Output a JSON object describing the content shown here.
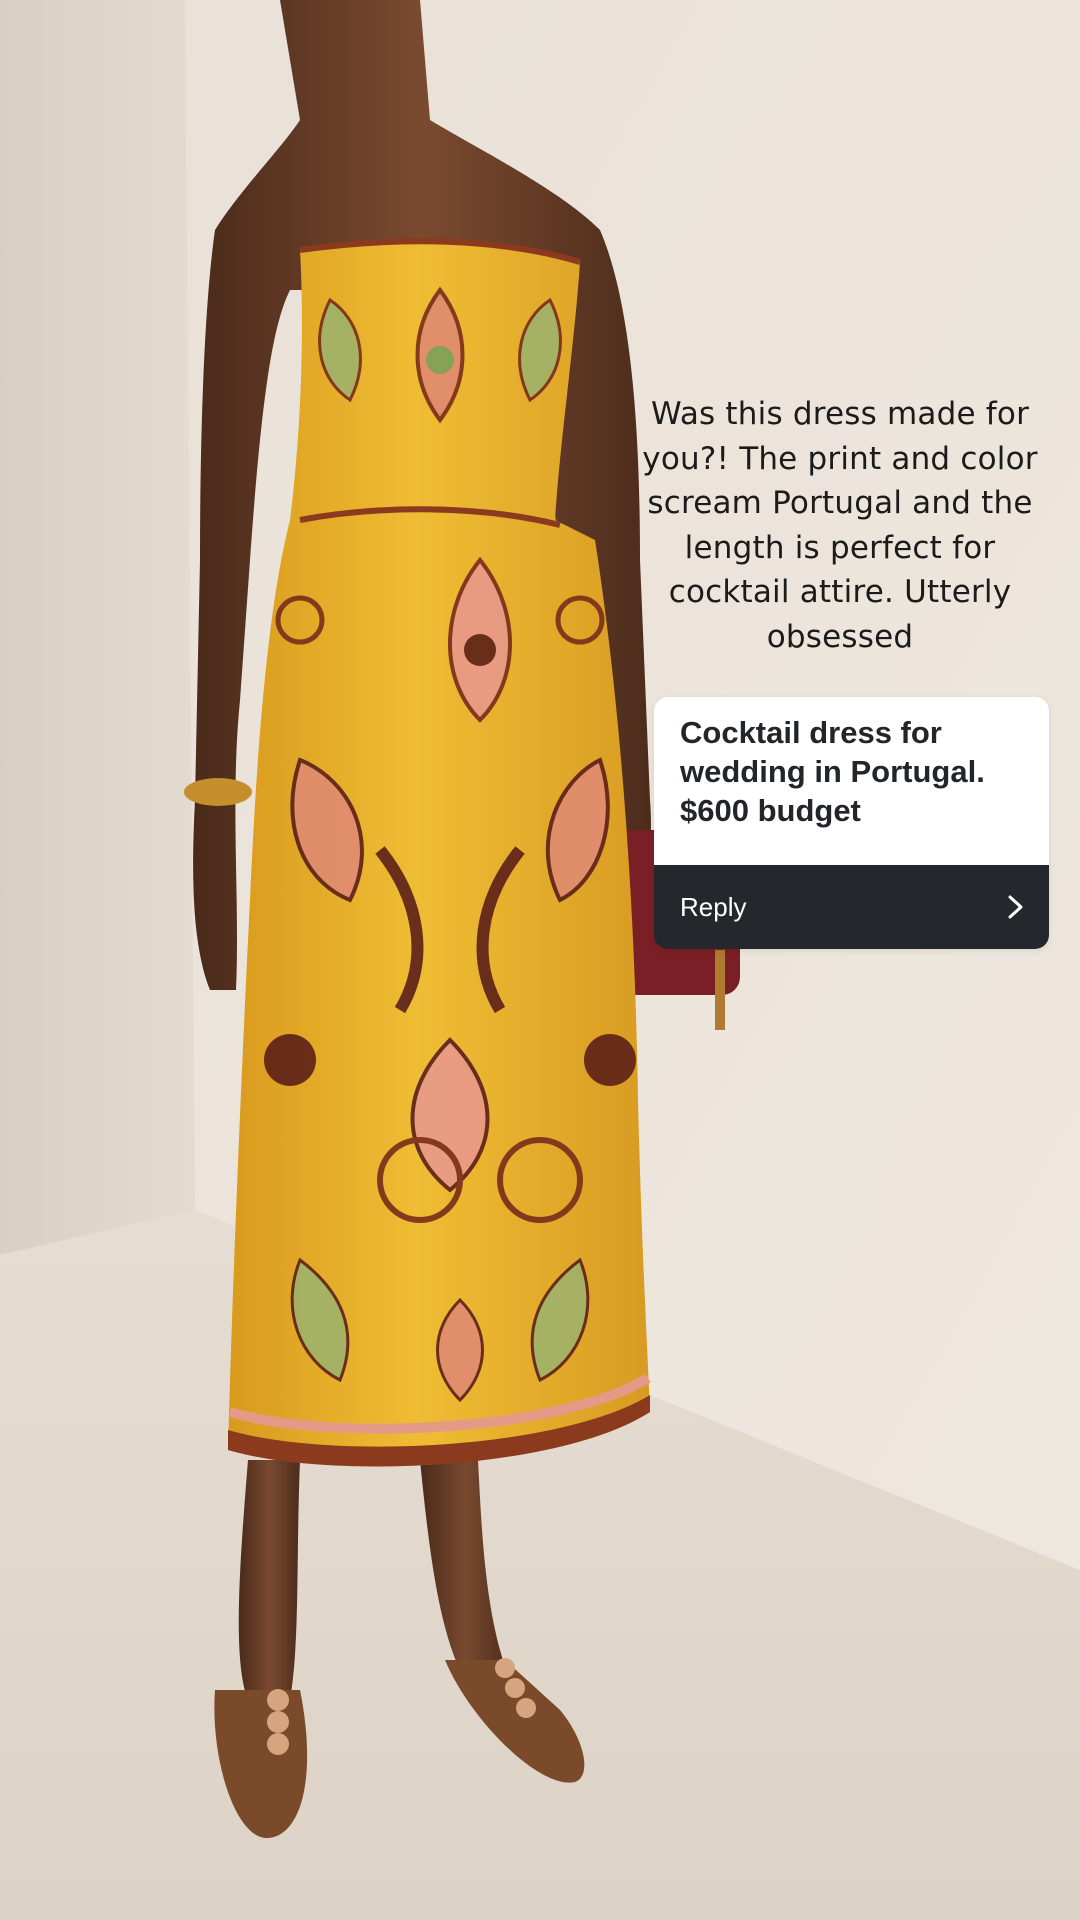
{
  "caption": "Was this dress made for you?! The print and color scream Portugal and the length is perfect for cocktail attire. Utterly obsessed",
  "question_sticker": {
    "question": "Cocktail dress for wedding in Portugal. $600 budget",
    "reply_label": "Reply",
    "reply_icon": "chevron-right-icon"
  },
  "colors": {
    "background_wall": "#e6ddd3",
    "dress_yellow": "#e8b22c",
    "sticker_dark": "#24282d",
    "sticker_light": "#ffffff"
  }
}
